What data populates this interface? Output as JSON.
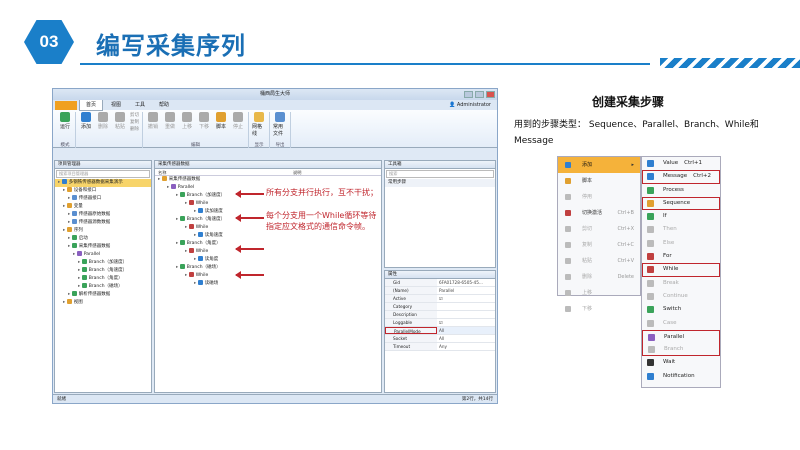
{
  "slide": {
    "number": "03",
    "title": "编写采集序列",
    "accent": "#1a7fc9"
  },
  "app": {
    "window_title": "桶西局生大师",
    "menu": [
      "首页",
      "视图",
      "工具",
      "帮助"
    ],
    "user": "Administrator",
    "ribbon_groups": [
      {
        "label": "模式",
        "buttons": [
          {
            "label": "运行",
            "icon": "play-icon",
            "color": "#3aa35a"
          }
        ]
      },
      {
        "label": "",
        "buttons": [
          {
            "label": "添加",
            "icon": "add-icon",
            "color": "#2f7fd0"
          },
          {
            "label": "删除",
            "icon": "delete-icon",
            "color": "#aaa"
          },
          {
            "label": "粘贴",
            "icon": "paste-icon",
            "color": "#aaa"
          }
        ],
        "small": [
          "剪切",
          "复制",
          "删除"
        ]
      },
      {
        "label": "编辑",
        "buttons": [
          {
            "label": "撤销",
            "icon": "undo-icon",
            "color": "#aaa"
          },
          {
            "label": "重做",
            "icon": "redo-icon",
            "color": "#aaa"
          },
          {
            "label": "上移",
            "icon": "up-icon",
            "color": "#aaa"
          },
          {
            "label": "下移",
            "icon": "down-icon",
            "color": "#aaa"
          },
          {
            "label": "脚本",
            "icon": "script-icon",
            "color": "#e0a030"
          },
          {
            "label": "停止",
            "icon": "stop-icon",
            "color": "#aaa"
          }
        ]
      },
      {
        "label": "显示",
        "buttons": [
          {
            "label": "网格线",
            "icon": "grid-icon",
            "color": "#e8b84a"
          }
        ]
      },
      {
        "label": "导出",
        "buttons": [
          {
            "label": "常用文件",
            "icon": "file-icon",
            "color": "#5a8fd0"
          }
        ]
      }
    ],
    "left_pane": {
      "title": "项目管理器",
      "search_placeholder": "搜索项目管理器",
      "items": [
        {
          "label": "多钢铁传感器数据采集演示",
          "level": 0,
          "selected": true,
          "color": "#2f7fd0"
        },
        {
          "label": "设备和接口",
          "level": 1,
          "selected": false,
          "color": "#e0a030"
        },
        {
          "label": "传感器接口",
          "level": 2,
          "selected": false,
          "color": "#5a8fd0"
        },
        {
          "label": "变量",
          "level": 1,
          "selected": false,
          "color": "#e0a030"
        },
        {
          "label": "传感器原始数据",
          "level": 2,
          "selected": false,
          "color": "#5a8fd0"
        },
        {
          "label": "传感器源数数据",
          "level": 2,
          "selected": false,
          "color": "#5a8fd0"
        },
        {
          "label": "序列",
          "level": 1,
          "selected": false,
          "color": "#e0a030"
        },
        {
          "label": "启动",
          "level": 2,
          "selected": false,
          "color": "#3aa35a"
        },
        {
          "label": "采集传感器数据",
          "level": 2,
          "selected": false,
          "color": "#3aa35a"
        },
        {
          "label": "Parallel",
          "level": 3,
          "selected": false,
          "color": "#8a5fc0"
        },
        {
          "label": "Branch（加速度）",
          "level": 4,
          "selected": false,
          "color": "#3aa35a"
        },
        {
          "label": "Branch（角速度）",
          "level": 4,
          "selected": false,
          "color": "#3aa35a"
        },
        {
          "label": "Branch（角度）",
          "level": 4,
          "selected": false,
          "color": "#3aa35a"
        },
        {
          "label": "Branch（磁场）",
          "level": 4,
          "selected": false,
          "color": "#3aa35a"
        },
        {
          "label": "解析传感器数据",
          "level": 2,
          "selected": false,
          "color": "#3aa35a"
        },
        {
          "label": "视图",
          "level": 1,
          "selected": false,
          "color": "#e0a030"
        }
      ]
    },
    "center_pane": {
      "tab": "采集传感器数据",
      "columns": [
        "名称",
        "说明"
      ],
      "rows": [
        {
          "label": "采集传感器数据",
          "level": 0,
          "color": "#e0a030"
        },
        {
          "label": "Parallel",
          "level": 1,
          "color": "#8a5fc0"
        },
        {
          "label": "Branch（加速度）",
          "level": 2,
          "color": "#3aa35a"
        },
        {
          "label": "While",
          "level": 3,
          "color": "#c04040"
        },
        {
          "label": "读加速度",
          "level": 4,
          "color": "#2f7fd0"
        },
        {
          "label": "Branch（角速度）",
          "level": 2,
          "color": "#3aa35a"
        },
        {
          "label": "While",
          "level": 3,
          "color": "#c04040"
        },
        {
          "label": "读角速度",
          "level": 4,
          "color": "#2f7fd0"
        },
        {
          "label": "Branch（角度）",
          "level": 2,
          "color": "#3aa35a"
        },
        {
          "label": "While",
          "level": 3,
          "color": "#c04040"
        },
        {
          "label": "读角度",
          "level": 4,
          "color": "#2f7fd0"
        },
        {
          "label": "Branch（磁场）",
          "level": 2,
          "color": "#3aa35a"
        },
        {
          "label": "While",
          "level": 3,
          "color": "#c04040"
        },
        {
          "label": "读磁场",
          "level": 4,
          "color": "#2f7fd0"
        }
      ]
    },
    "toolbox": {
      "title": "工具箱",
      "search_placeholder": "搜索",
      "section": "常用步骤"
    },
    "properties": {
      "title": "属性",
      "rows": [
        {
          "k": "Gid",
          "v": "6FA01728-6505-45..."
        },
        {
          "k": "(Name)",
          "v": "Parallel"
        },
        {
          "k": "Active",
          "v": "☑"
        },
        {
          "k": "Category",
          "v": ""
        },
        {
          "k": "Description",
          "v": ""
        },
        {
          "k": "Loggable",
          "v": "☑"
        },
        {
          "k": "ParallelMode",
          "v": "All"
        },
        {
          "k": "Socket",
          "v": "All"
        },
        {
          "k": "Timeout",
          "v": "Any"
        }
      ]
    },
    "status": {
      "left": "就绪",
      "right": "第2行，共14行"
    },
    "annotations": [
      "所有分支并行执行，互不干扰；",
      "每个分支用一个While循环等待指定应文格式的通信命令帧。"
    ]
  },
  "right": {
    "title": "创建采集步骤",
    "desc": "用到的步骤类型： Sequence、Parallel、Branch、While和Message",
    "menu1": [
      {
        "label": "添加",
        "sc": "",
        "state": "active",
        "icon": "add-icon",
        "color": "#2f7fd0"
      },
      {
        "label": "脚本",
        "sc": "",
        "state": "normal",
        "icon": "script-icon",
        "color": "#e0a030"
      },
      {
        "label": "停用",
        "sc": "",
        "state": "disabled",
        "icon": "disable-icon",
        "color": "#bbb"
      },
      {
        "label": "切换激活",
        "sc": "Ctrl+B",
        "state": "normal",
        "icon": "toggle-icon",
        "color": "#c04040"
      },
      {
        "label": "剪切",
        "sc": "Ctrl+X",
        "state": "disabled",
        "icon": "cut-icon",
        "color": "#bbb"
      },
      {
        "label": "复制",
        "sc": "Ctrl+C",
        "state": "disabled",
        "icon": "copy-icon",
        "color": "#bbb"
      },
      {
        "label": "粘贴",
        "sc": "Ctrl+V",
        "state": "disabled",
        "icon": "paste-icon",
        "color": "#bbb"
      },
      {
        "label": "删除",
        "sc": "Delete",
        "state": "disabled",
        "icon": "delete-icon",
        "color": "#bbb"
      },
      {
        "label": "上移",
        "sc": "",
        "state": "disabled",
        "icon": "up-icon",
        "color": "#bbb"
      },
      {
        "label": "下移",
        "sc": "",
        "state": "disabled",
        "icon": "down-icon",
        "color": "#bbb"
      }
    ],
    "menu2": [
      {
        "label": "Value",
        "sc": "Ctrl+1",
        "state": "normal",
        "icon": "value-icon",
        "color": "#2f7fd0"
      },
      {
        "label": "Message",
        "sc": "Ctrl+2",
        "state": "boxed",
        "icon": "message-icon",
        "color": "#2f7fd0"
      },
      {
        "label": "Process",
        "sc": "",
        "state": "normal",
        "icon": "process-icon",
        "color": "#3aa35a"
      },
      {
        "label": "Sequence",
        "sc": "",
        "state": "boxed",
        "icon": "sequence-icon",
        "color": "#e0a030"
      },
      {
        "label": "If",
        "sc": "",
        "state": "normal",
        "icon": "if-icon",
        "color": "#3aa35a"
      },
      {
        "label": "Then",
        "sc": "",
        "state": "disabled",
        "icon": "then-icon",
        "color": "#bbb"
      },
      {
        "label": "Else",
        "sc": "",
        "state": "disabled",
        "icon": "else-icon",
        "color": "#bbb"
      },
      {
        "label": "For",
        "sc": "",
        "state": "normal",
        "icon": "for-icon",
        "color": "#c04040"
      },
      {
        "label": "While",
        "sc": "",
        "state": "boxed",
        "icon": "while-icon",
        "color": "#c04040"
      },
      {
        "label": "Break",
        "sc": "",
        "state": "disabled",
        "icon": "break-icon",
        "color": "#bbb"
      },
      {
        "label": "Continue",
        "sc": "",
        "state": "disabled",
        "icon": "continue-icon",
        "color": "#bbb"
      },
      {
        "label": "Switch",
        "sc": "",
        "state": "normal",
        "icon": "switch-icon",
        "color": "#3aa35a"
      },
      {
        "label": "Case",
        "sc": "",
        "state": "disabled",
        "icon": "case-icon",
        "color": "#bbb"
      },
      {
        "label": "Parallel",
        "sc": "",
        "state": "group-top",
        "icon": "parallel-icon",
        "color": "#8a5fc0"
      },
      {
        "label": "Branch",
        "sc": "",
        "state": "group-bottom-disabled",
        "icon": "branch-icon",
        "color": "#bbb"
      },
      {
        "label": "Wait",
        "sc": "",
        "state": "normal",
        "icon": "wait-icon",
        "color": "#333"
      },
      {
        "label": "Notification",
        "sc": "",
        "state": "normal",
        "icon": "notification-icon",
        "color": "#2f7fd0"
      }
    ]
  }
}
